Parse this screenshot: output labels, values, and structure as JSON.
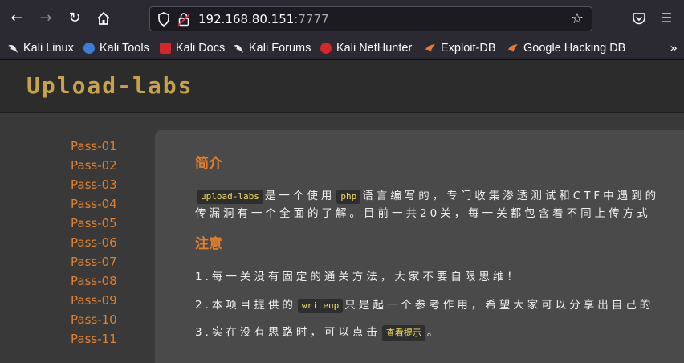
{
  "browser": {
    "url_host": "192.168.80.151",
    "url_port": ":7777",
    "icons": {
      "back": "back-arrow-icon",
      "forward": "forward-arrow-icon",
      "reload": "reload-icon",
      "home": "home-icon",
      "shield": "shield-icon",
      "lock": "insecure-lock-icon",
      "star": "bookmark-star-icon",
      "pocket": "pocket-icon",
      "menu": "hamburger-menu-icon"
    },
    "bookmarks": [
      {
        "label": "Kali Linux",
        "color": "#e6e6e6"
      },
      {
        "label": "Kali Tools",
        "color": "#3b7dd8"
      },
      {
        "label": "Kali Docs",
        "color": "#d7262b"
      },
      {
        "label": "Kali Forums",
        "color": "#e6e6e6"
      },
      {
        "label": "Kali NetHunter",
        "color": "#d7262b"
      },
      {
        "label": "Exploit-DB",
        "color": "#e87830"
      },
      {
        "label": "Google Hacking DB",
        "color": "#e87830"
      }
    ]
  },
  "site": {
    "logo": "Upload-labs",
    "sidebar": [
      "Pass-01",
      "Pass-02",
      "Pass-03",
      "Pass-04",
      "Pass-05",
      "Pass-06",
      "Pass-07",
      "Pass-08",
      "Pass-09",
      "Pass-10",
      "Pass-11"
    ],
    "intro_title": "简介",
    "intro_code1": "upload-labs",
    "intro_text1": "是一个使用",
    "intro_code2": "php",
    "intro_text2": "语言编写的，专门收集渗透测试和CTF中遇到的",
    "intro_line2": "传漏洞有一个全面的了解。目前一共20关，每一关都包含着不同上传方式",
    "notice_title": "注意",
    "notice1": "1.每一关没有固定的通关方法，大家不要自限思维！",
    "notice2_a": "2.本项目提供的",
    "notice2_code": "writeup",
    "notice2_b": "只是起一个参考作用，希望大家可以分享出自己的",
    "notice3_a": "3.实在没有思路时，可以点击",
    "notice3_btn": "查看提示",
    "notice3_b": "。"
  },
  "colors": {
    "accent": "#e37f2a",
    "code_text": "#f7df5c",
    "logo": "#c8a24a"
  }
}
